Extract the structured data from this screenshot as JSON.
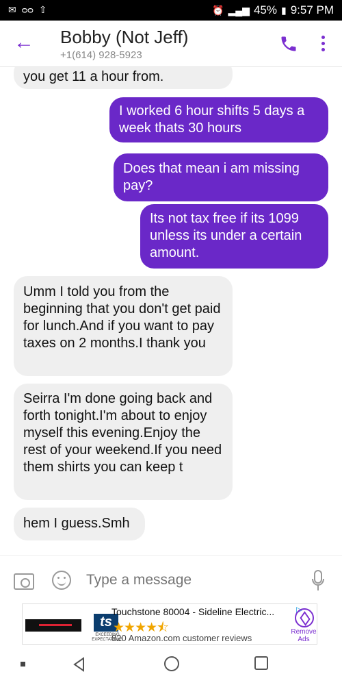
{
  "status_bar": {
    "battery": "45%",
    "time": "9:57 PM",
    "icons": [
      "gmail-icon",
      "voicemail-icon",
      "upload-icon",
      "alarm-icon",
      "signal-icon",
      "battery-icon"
    ]
  },
  "header": {
    "contact_name": "Bobby (Not Jeff)",
    "phone": "+1(614) 928-5923",
    "accent_color": "#7b2fd0"
  },
  "messages": [
    {
      "direction": "in",
      "text": "you get 11 a hour from."
    },
    {
      "direction": "out",
      "text": "I worked 6 hour shifts 5 days a week thats 30 hours"
    },
    {
      "direction": "out",
      "text": "Does that mean i am missing pay?"
    },
    {
      "direction": "out",
      "text": "Its not tax free if its 1099 unless its under a certain amount."
    },
    {
      "direction": "in",
      "text": "Umm I told you from the beginning that you don't get paid for lunch.And if you want to pay taxes on 2 months.I thank you"
    },
    {
      "direction": "in",
      "text": "Seirra I'm done going back and forth tonight.I'm about to enjoy myself this evening.Enjoy the rest of your weekend.If you need them shirts you can keep t"
    },
    {
      "direction": "in",
      "text": "hem I guess.Smh"
    }
  ],
  "composer": {
    "placeholder": "Type a message"
  },
  "ad": {
    "title": "Touchstone 80004 - Sideline Electric...",
    "rating_stars": 4.5,
    "reviews": "820 Amazon.com customer reviews",
    "logo_text": "ts",
    "tagline": "EXCEEDING EXPECTATIONS",
    "remove_label": "Remove Ads"
  }
}
